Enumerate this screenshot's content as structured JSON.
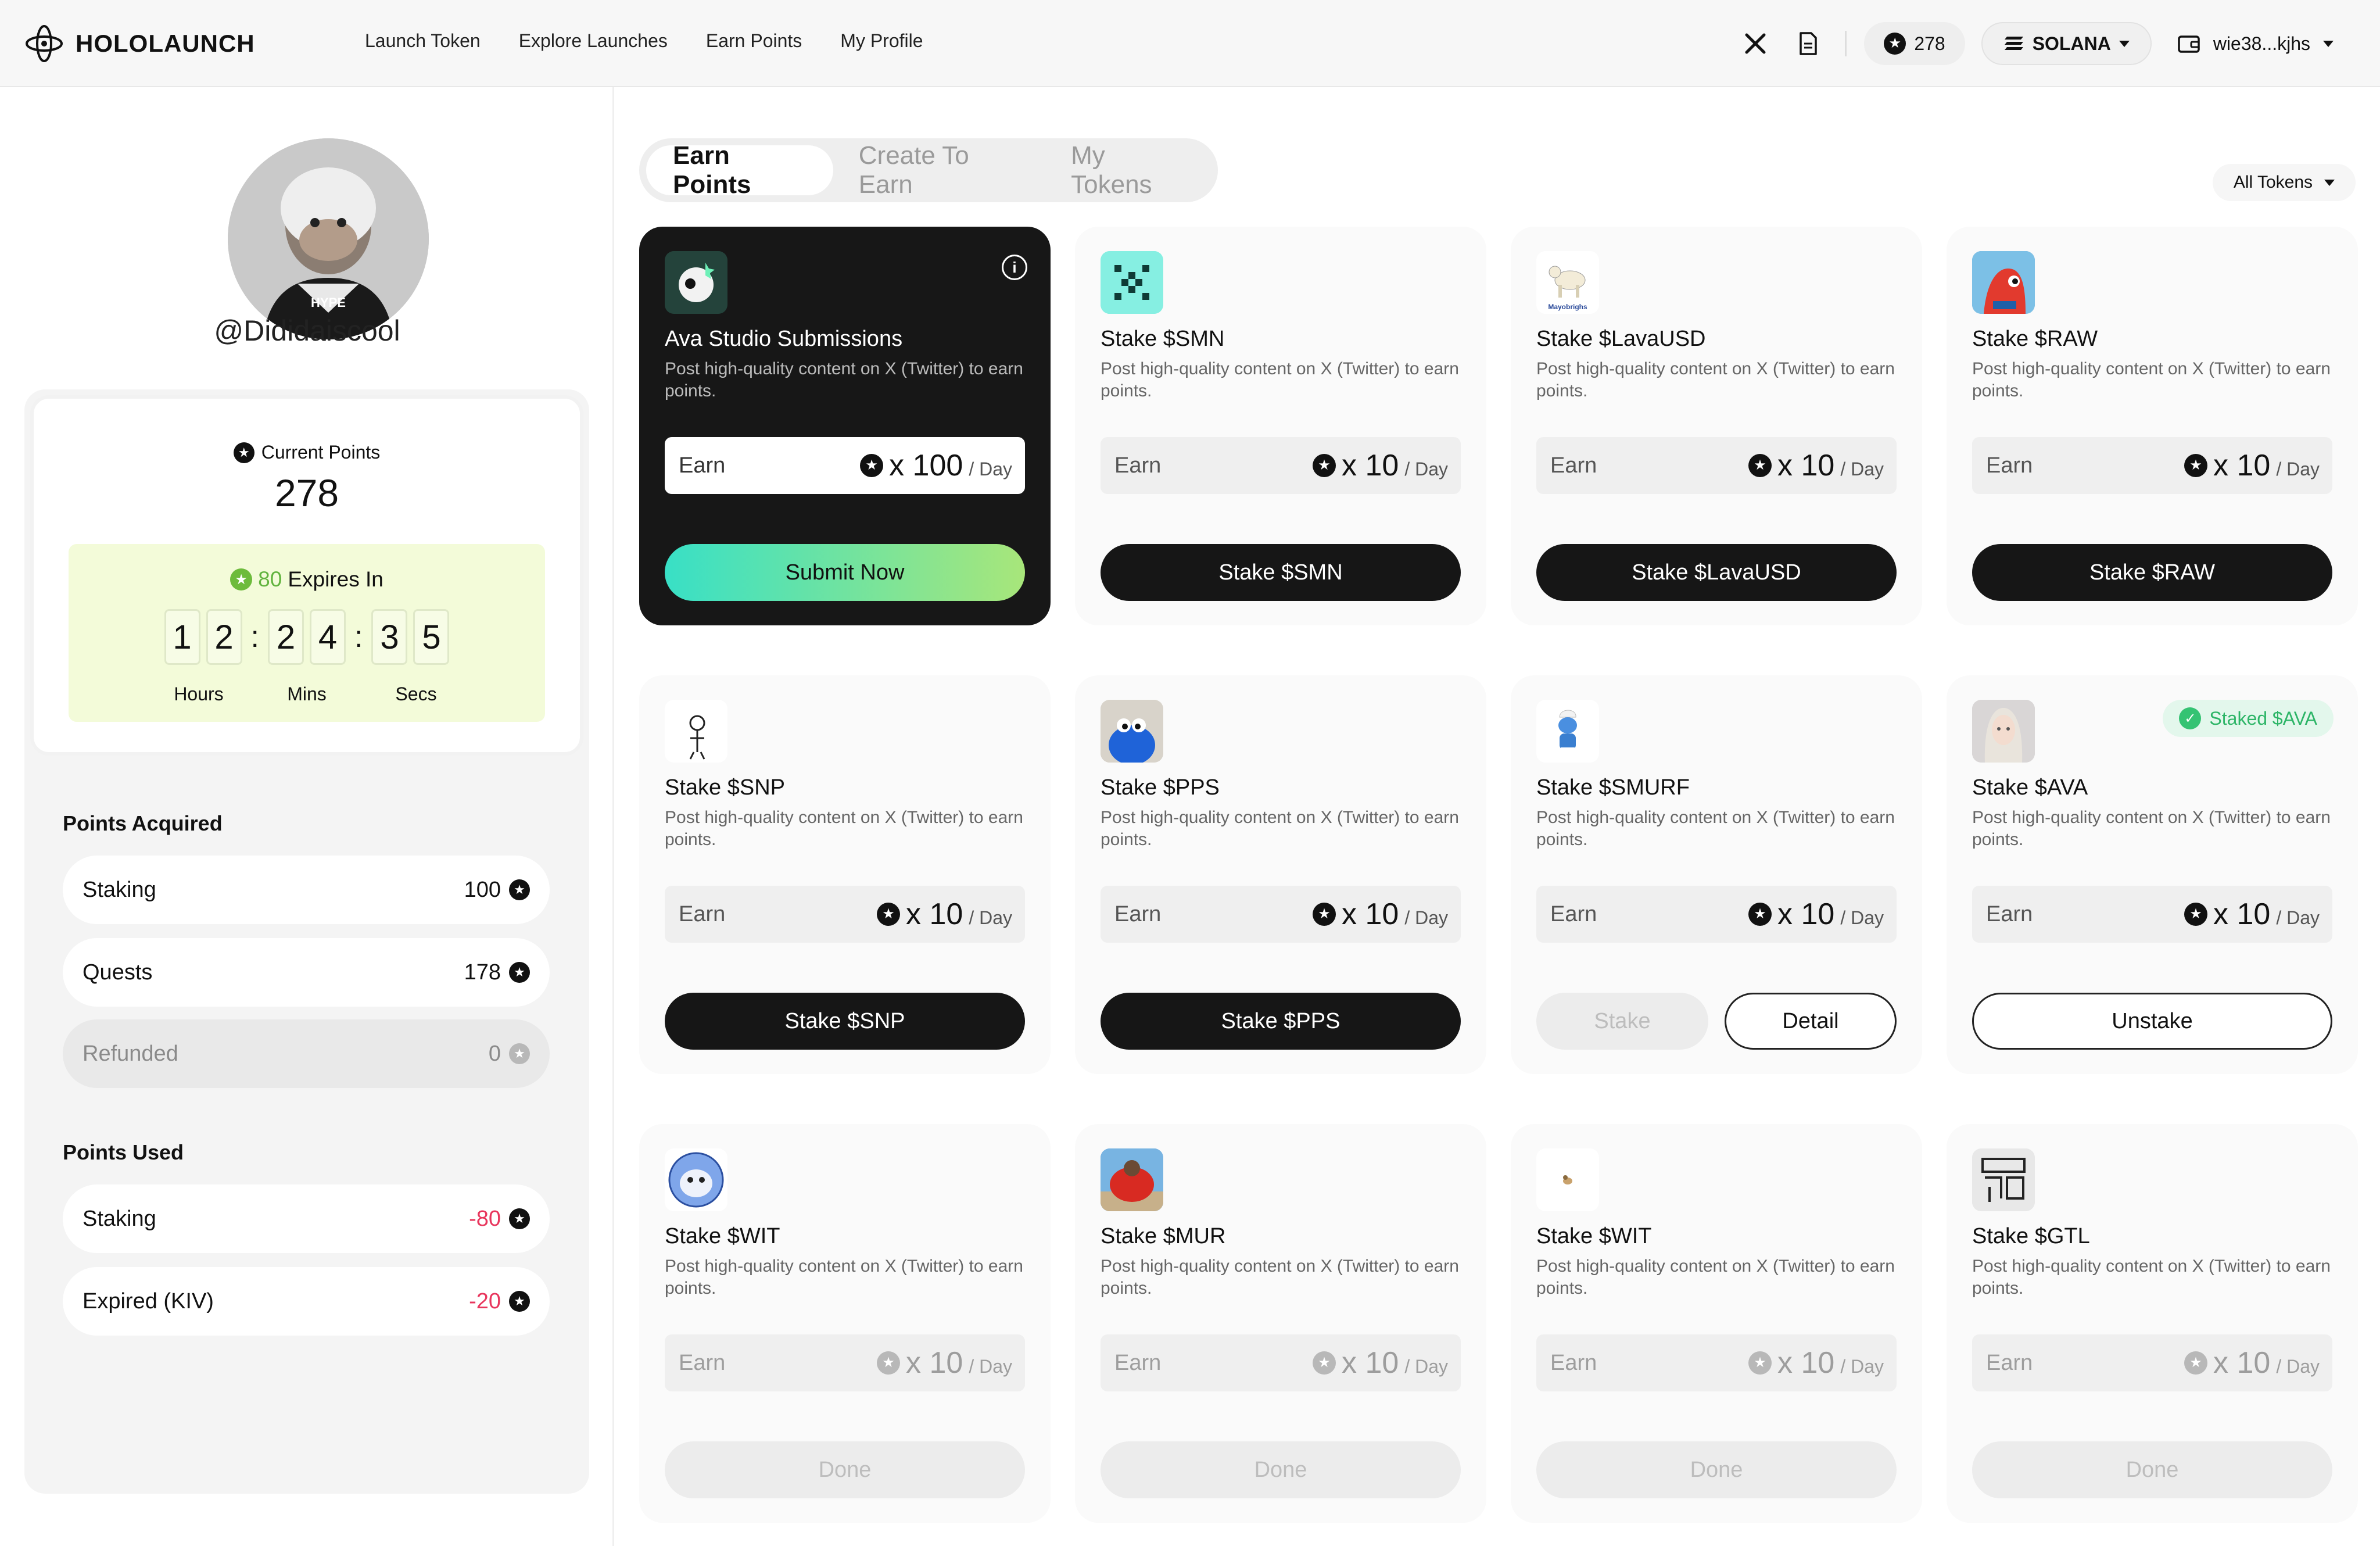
{
  "header": {
    "brand": "HOLOLAUNCH",
    "nav": [
      "Launch Token",
      "Explore Launches",
      "Earn Points",
      "My Profile"
    ],
    "points": "278",
    "chain": "SOLANA",
    "wallet": "wie38...kjhs"
  },
  "profile": {
    "username": "@Dididaiscool",
    "current_points_label": "Current Points",
    "current_points": "278",
    "expiring_points": "80",
    "expires_label": "Expires In",
    "countdown": [
      "1",
      "2",
      "2",
      "4",
      "3",
      "5"
    ],
    "unit_labels": [
      "Hours",
      "Mins",
      "Secs"
    ]
  },
  "acquired": {
    "title": "Points Acquired",
    "rows": [
      {
        "label": "Staking",
        "value": "100"
      },
      {
        "label": "Quests",
        "value": "178"
      },
      {
        "label": "Refunded",
        "value": "0"
      }
    ]
  },
  "used": {
    "title": "Points Used",
    "rows": [
      {
        "label": "Staking",
        "value": "-80"
      },
      {
        "label": "Expired (KIV)",
        "value": "-20"
      }
    ]
  },
  "tabs": [
    "Earn Points",
    "Create To Earn",
    "My Tokens"
  ],
  "filter": "All Tokens",
  "earn_label": "Earn",
  "per_day": "/ Day",
  "cards": [
    {
      "title": "Ava Studio Submissions",
      "desc": "Post high-quality content on X (Twitter) to earn points.",
      "mult": "x 100",
      "button": "Submit Now"
    },
    {
      "title": "Stake $SMN",
      "desc": "Post high-quality content on X (Twitter) to earn points.",
      "mult": "x 10",
      "button": "Stake $SMN"
    },
    {
      "title": "Stake $LavaUSD",
      "desc": "Post high-quality content on X (Twitter) to earn points.",
      "mult": "x 10",
      "button": "Stake $LavaUSD"
    },
    {
      "title": "Stake $RAW",
      "desc": "Post high-quality content on X (Twitter) to earn points.",
      "mult": "x 10",
      "button": "Stake $RAW"
    },
    {
      "title": "Stake $SNP",
      "desc": "Post high-quality content on X (Twitter) to earn points.",
      "mult": "x 10",
      "button": "Stake $SNP"
    },
    {
      "title": "Stake $PPS",
      "desc": "Post high-quality content on X (Twitter) to earn points.",
      "mult": "x 10",
      "button": "Stake $PPS"
    },
    {
      "title": "Stake $SMURF",
      "desc": "Post high-quality content on X (Twitter) to earn points.",
      "mult": "x 10",
      "button": "Stake",
      "button2": "Detail"
    },
    {
      "title": "Stake $AVA",
      "desc": "Post high-quality content on X (Twitter) to earn points.",
      "mult": "x 10",
      "button": "Unstake",
      "badge": "Staked $AVA"
    },
    {
      "title": "Stake $WIT",
      "desc": "Post high-quality content on X (Twitter) to earn points.",
      "mult": "x 10",
      "button": "Done"
    },
    {
      "title": "Stake $MUR",
      "desc": "Post high-quality content on X (Twitter) to earn points.",
      "mult": "x 10",
      "button": "Done"
    },
    {
      "title": "Stake $WIT",
      "desc": "Post high-quality content on X (Twitter) to earn points.",
      "mult": "x 10",
      "button": "Done"
    },
    {
      "title": "Stake $GTL",
      "desc": "Post high-quality content on X (Twitter) to earn points.",
      "mult": "x 10",
      "button": "Done"
    }
  ],
  "colors": {
    "accent_gradient_start": "#38e0c6",
    "accent_gradient_end": "#a8e67a",
    "negative": "#e8365d",
    "staked": "#2db567"
  }
}
